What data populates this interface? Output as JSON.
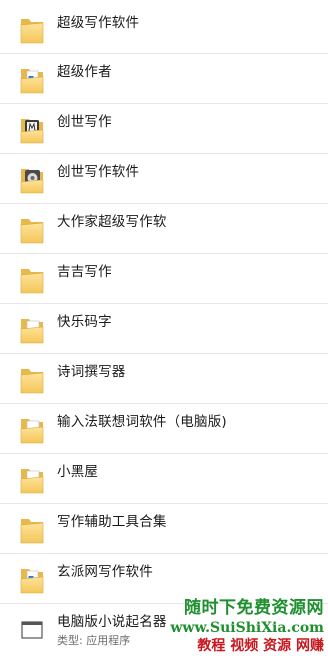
{
  "items": [
    {
      "label": "超级写作软件",
      "icon": "folder-icon"
    },
    {
      "label": "超级作者",
      "icon": "folder-blue-doc-icon"
    },
    {
      "label": "创世写作",
      "icon": "folder-app-icon"
    },
    {
      "label": "创世写作软件",
      "icon": "folder-app-icon"
    },
    {
      "label": "大作家超级写作软",
      "icon": "folder-icon"
    },
    {
      "label": "吉吉写作",
      "icon": "folder-icon"
    },
    {
      "label": "快乐码字",
      "icon": "folder-red-doc-icon"
    },
    {
      "label": "诗词撰写器",
      "icon": "folder-icon"
    },
    {
      "label": "输入法联想词软件（电脑版)",
      "icon": "folder-green-doc-icon"
    },
    {
      "label": "小黑屋",
      "icon": "folder-doc-icon"
    },
    {
      "label": "写作辅助工具合集",
      "icon": "folder-icon"
    },
    {
      "label": "玄派网写作软件",
      "icon": "folder-blue-doc-icon"
    },
    {
      "label": "电脑版小说起名器",
      "sublabel": "类型: 应用程序",
      "icon": "application-icon"
    }
  ],
  "watermark": {
    "line1": "随时下免费资源网",
    "line2": "www.SuiShiXia.com",
    "line3": "教程 视频 资源 网赚"
  },
  "colors": {
    "folder": "#f6cf6b",
    "divider": "#e6e6e6",
    "watermark_green": "#1f8f2f",
    "watermark_red": "#c8181f"
  }
}
